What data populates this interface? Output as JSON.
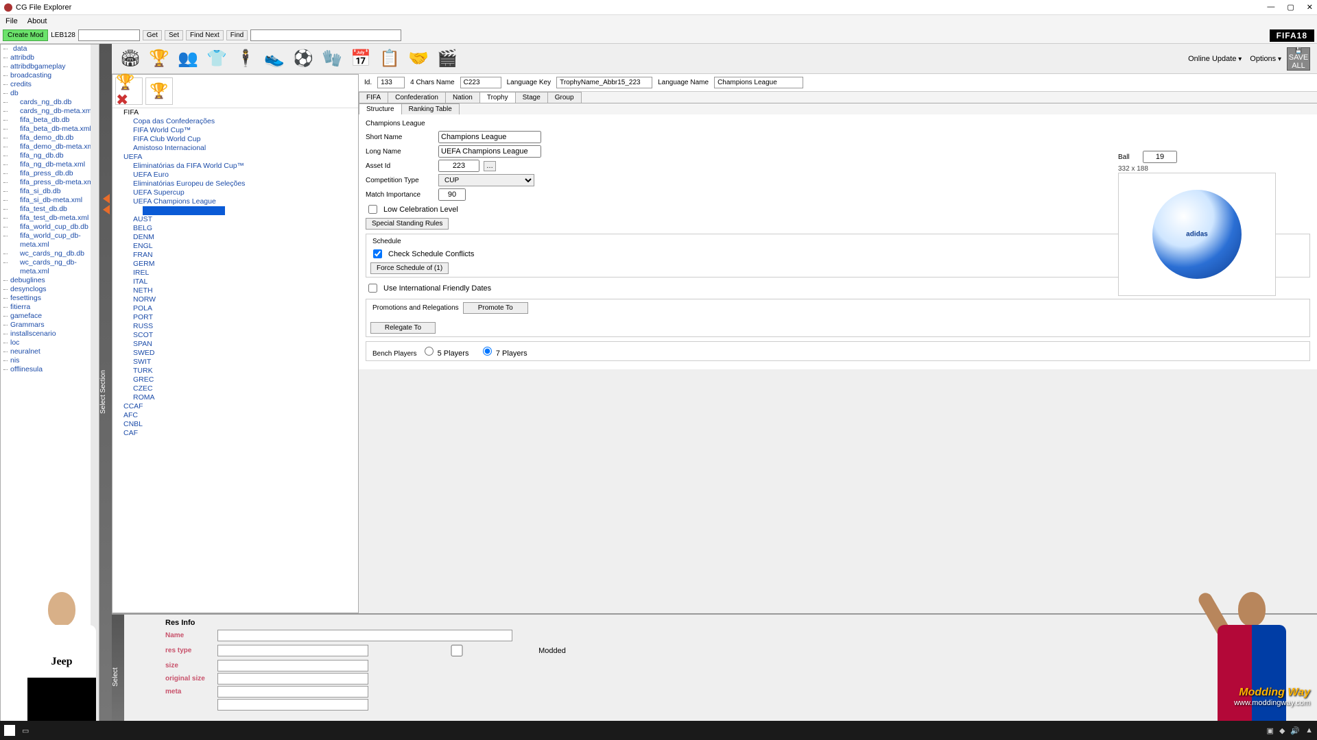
{
  "window": {
    "title": "CG File Explorer"
  },
  "menu": {
    "file": "File",
    "about": "About"
  },
  "toolbar": {
    "create_mod": "Create Mod",
    "leb": "LEB128",
    "get": "Get",
    "set": "Set",
    "find_next": "Find Next",
    "find": "Find",
    "fifa_logo": "FIFA18"
  },
  "left_tree": {
    "items": [
      {
        "l": 0,
        "t": "data"
      },
      {
        "l": 1,
        "t": "attribdb"
      },
      {
        "l": 1,
        "t": "attribdbgameplay"
      },
      {
        "l": 1,
        "t": "broadcasting"
      },
      {
        "l": 1,
        "t": "credits"
      },
      {
        "l": 1,
        "t": "db"
      },
      {
        "l": 2,
        "t": "cards_ng_db.db"
      },
      {
        "l": 2,
        "t": "cards_ng_db-meta.xml"
      },
      {
        "l": 2,
        "t": "fifa_beta_db.db"
      },
      {
        "l": 2,
        "t": "fifa_beta_db-meta.xml"
      },
      {
        "l": 2,
        "t": "fifa_demo_db.db"
      },
      {
        "l": 2,
        "t": "fifa_demo_db-meta.xml"
      },
      {
        "l": 2,
        "t": "fifa_ng_db.db"
      },
      {
        "l": 2,
        "t": "fifa_ng_db-meta.xml"
      },
      {
        "l": 2,
        "t": "fifa_press_db.db"
      },
      {
        "l": 2,
        "t": "fifa_press_db-meta.xml"
      },
      {
        "l": 2,
        "t": "fifa_si_db.db"
      },
      {
        "l": 2,
        "t": "fifa_si_db-meta.xml"
      },
      {
        "l": 2,
        "t": "fifa_test_db.db"
      },
      {
        "l": 2,
        "t": "fifa_test_db-meta.xml"
      },
      {
        "l": 2,
        "t": "fifa_world_cup_db.db"
      },
      {
        "l": 2,
        "t": "fifa_world_cup_db-meta.xml"
      },
      {
        "l": 2,
        "t": "wc_cards_ng_db.db"
      },
      {
        "l": 2,
        "t": "wc_cards_ng_db-meta.xml"
      },
      {
        "l": 1,
        "t": "debuglines"
      },
      {
        "l": 1,
        "t": "desynclogs"
      },
      {
        "l": 1,
        "t": "fesettings"
      },
      {
        "l": 1,
        "t": "fitierra"
      },
      {
        "l": 1,
        "t": "gameface"
      },
      {
        "l": 1,
        "t": "Grammars"
      },
      {
        "l": 1,
        "t": "installscenario"
      },
      {
        "l": 1,
        "t": "loc"
      },
      {
        "l": 1,
        "t": "neuralnet"
      },
      {
        "l": 1,
        "t": "nis"
      },
      {
        "l": 1,
        "t": "offlinesula"
      }
    ]
  },
  "sidebar_tab": "Select Section",
  "iconbar": {
    "online_update": "Online Update",
    "options": "Options",
    "save_all": "SAVE ALL"
  },
  "trophy_tree": {
    "items": [
      {
        "l": 0,
        "t": "FIFA",
        "c": ""
      },
      {
        "l": 1,
        "t": "Copa das Confederações",
        "c": "blue"
      },
      {
        "l": 1,
        "t": "FIFA World Cup™",
        "c": "blue"
      },
      {
        "l": 1,
        "t": "FIFA Club World Cup",
        "c": "blue"
      },
      {
        "l": 1,
        "t": "Amistoso Internacional",
        "c": "blue"
      },
      {
        "l": 0,
        "t": "UEFA",
        "c": "blue"
      },
      {
        "l": 1,
        "t": "Eliminatórias da FIFA World Cup™",
        "c": "blue"
      },
      {
        "l": 1,
        "t": "UEFA Euro",
        "c": "blue"
      },
      {
        "l": 1,
        "t": "Eliminatórias Europeu de Seleções",
        "c": "blue"
      },
      {
        "l": 1,
        "t": "UEFA Supercup",
        "c": "blue"
      },
      {
        "l": 1,
        "t": "UEFA Champions League",
        "c": "blue"
      },
      {
        "l": 1,
        "t": "",
        "c": "sel"
      },
      {
        "l": 1,
        "t": "AUST",
        "c": "blue"
      },
      {
        "l": 1,
        "t": "BELG",
        "c": "blue"
      },
      {
        "l": 1,
        "t": "DENM",
        "c": "blue"
      },
      {
        "l": 1,
        "t": "ENGL",
        "c": "blue"
      },
      {
        "l": 1,
        "t": "FRAN",
        "c": "blue"
      },
      {
        "l": 1,
        "t": "GERM",
        "c": "blue"
      },
      {
        "l": 1,
        "t": "IREL",
        "c": "blue"
      },
      {
        "l": 1,
        "t": "ITAL",
        "c": "blue"
      },
      {
        "l": 1,
        "t": "NETH",
        "c": "blue"
      },
      {
        "l": 1,
        "t": "NORW",
        "c": "blue"
      },
      {
        "l": 1,
        "t": "POLA",
        "c": "blue"
      },
      {
        "l": 1,
        "t": "PORT",
        "c": "blue"
      },
      {
        "l": 1,
        "t": "RUSS",
        "c": "blue"
      },
      {
        "l": 1,
        "t": "SCOT",
        "c": "blue"
      },
      {
        "l": 1,
        "t": "SPAN",
        "c": "blue"
      },
      {
        "l": 1,
        "t": "SWED",
        "c": "blue"
      },
      {
        "l": 1,
        "t": "SWIT",
        "c": "blue"
      },
      {
        "l": 1,
        "t": "TURK",
        "c": "blue"
      },
      {
        "l": 1,
        "t": "GREC",
        "c": "blue"
      },
      {
        "l": 1,
        "t": "CZEC",
        "c": "blue"
      },
      {
        "l": 1,
        "t": "ROMA",
        "c": "blue"
      },
      {
        "l": 0,
        "t": "CCAF",
        "c": "blue"
      },
      {
        "l": 0,
        "t": "AFC",
        "c": "blue"
      },
      {
        "l": 0,
        "t": "CNBL",
        "c": "blue"
      },
      {
        "l": 0,
        "t": "CAF",
        "c": "blue"
      }
    ]
  },
  "detail": {
    "id_lbl": "Id.",
    "id_val": "133",
    "chars_lbl": "4 Chars Name",
    "chars_val": "C223",
    "langkey_lbl": "Language Key",
    "langkey_val": "TrophyName_Abbr15_223",
    "langname_lbl": "Language Name",
    "langname_val": "Champions League",
    "tabs": {
      "fifa": "FIFA",
      "confed": "Confederation",
      "nation": "Nation",
      "trophy": "Trophy",
      "stage": "Stage",
      "group": "Group"
    },
    "subtabs": {
      "structure": "Structure",
      "ranking": "Ranking Table"
    },
    "title": "Champions League",
    "short_name_lbl": "Short Name",
    "short_name": "Champions League",
    "long_name_lbl": "Long Name",
    "long_name": "UEFA Champions League",
    "asset_lbl": "Asset Id",
    "asset_val": "223",
    "comp_lbl": "Competition Type",
    "comp_val": "CUP",
    "match_lbl": "Match Importance",
    "match_val": "90",
    "lowceleb": "Low Celebration Level",
    "special_btn": "Special Standing Rules",
    "schedule_lbl": "Schedule",
    "check_sched": "Check Schedule Conflicts",
    "force_btn": "Force Schedule of (1)",
    "intl_dates": "Use International Friendly Dates",
    "promo_lbl": "Promotions and Relegations",
    "promote_btn": "Promote To",
    "relegate_btn": "Relegate To",
    "bench_lbl": "Bench Players",
    "bench5": "5 Players",
    "bench7": "7 Players",
    "ball_lbl": "Ball",
    "ball_val": "19",
    "ball_dim": "332 x 188"
  },
  "res_info": {
    "title": "Res Info",
    "name_lbl": "Name",
    "type_lbl": "res type",
    "size_lbl": "size",
    "orig_lbl": "original size",
    "meta_lbl": "meta",
    "extra_lbl": "",
    "modded": "Modded"
  },
  "watermark": {
    "brand": "Modding Way",
    "url": "www.moddingway.com"
  }
}
